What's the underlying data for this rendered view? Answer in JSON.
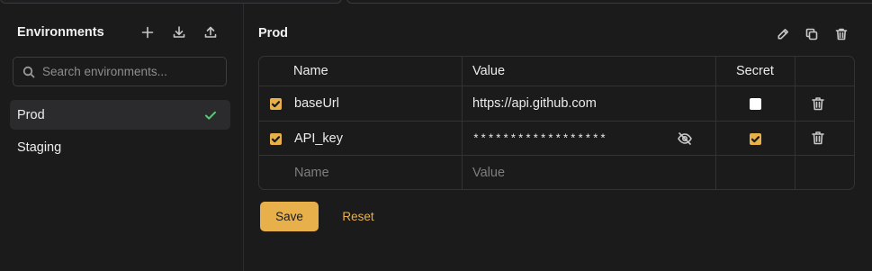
{
  "sidebar": {
    "title": "Environments",
    "search": {
      "placeholder": "Search environments...",
      "value": ""
    },
    "items": [
      {
        "label": "Prod",
        "active": true,
        "icon": "check-icon"
      },
      {
        "label": "Staging",
        "active": false
      }
    ],
    "actions": [
      "plus-icon",
      "download-icon",
      "upload-icon"
    ]
  },
  "main": {
    "title": "Prod",
    "actions": [
      "edit-icon",
      "copy-icon",
      "trash-icon"
    ],
    "table": {
      "headers": {
        "name": "Name",
        "value": "Value",
        "secret": "Secret"
      },
      "rows": [
        {
          "enabled": true,
          "name": "baseUrl",
          "value": "https://api.github.com",
          "secret": false
        },
        {
          "enabled": true,
          "name": "API_key",
          "value": "******************",
          "secret": true,
          "masked": true
        }
      ],
      "new_row": {
        "name_placeholder": "Name",
        "value_placeholder": "Value"
      }
    },
    "buttons": {
      "save": "Save",
      "reset": "Reset"
    }
  },
  "colors": {
    "accent": "#e8b04a",
    "active_check": "#5fc577",
    "background": "#1b1b1c"
  }
}
